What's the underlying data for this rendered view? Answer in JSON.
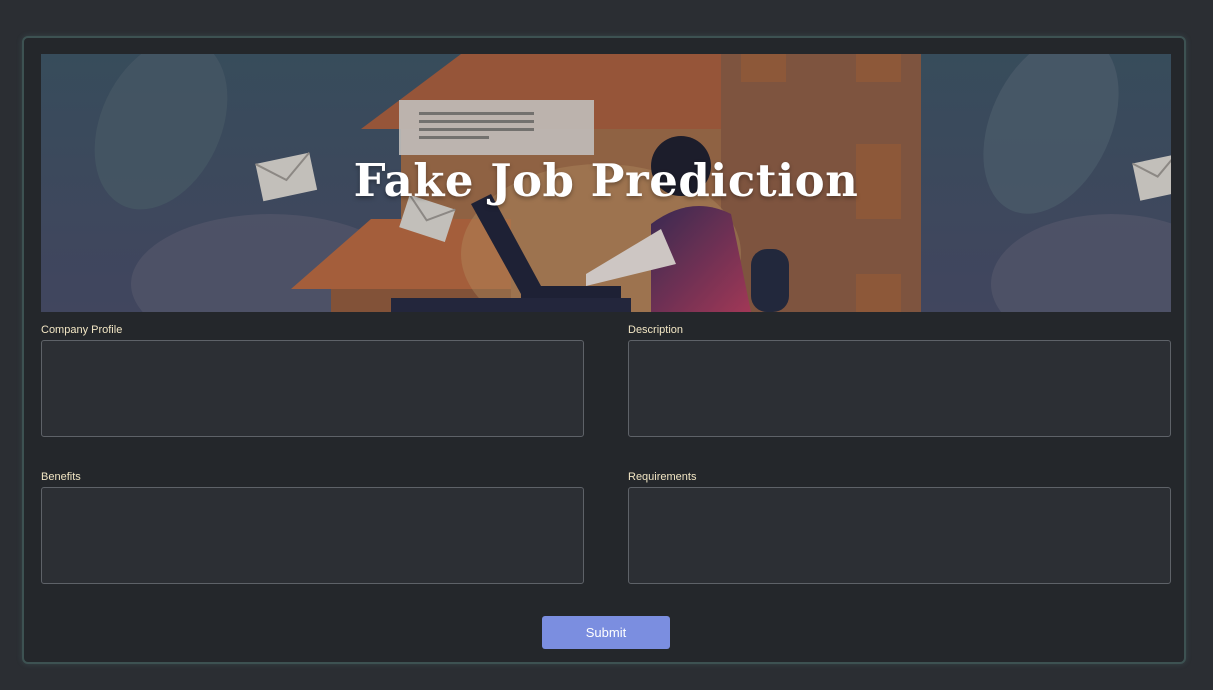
{
  "header": {
    "title": "Fake Job Prediction"
  },
  "form": {
    "fields": [
      {
        "label": "Company Profile",
        "value": "",
        "placeholder": ""
      },
      {
        "label": "Description",
        "value": "",
        "placeholder": ""
      },
      {
        "label": "Benefits",
        "value": "",
        "placeholder": ""
      },
      {
        "label": "Requirements",
        "value": "",
        "placeholder": ""
      }
    ],
    "submit_label": "Submit"
  },
  "colors": {
    "background": "#2b2e33",
    "card": "#24272b",
    "label": "#f2e6c4",
    "button": "#7b8ee0"
  }
}
